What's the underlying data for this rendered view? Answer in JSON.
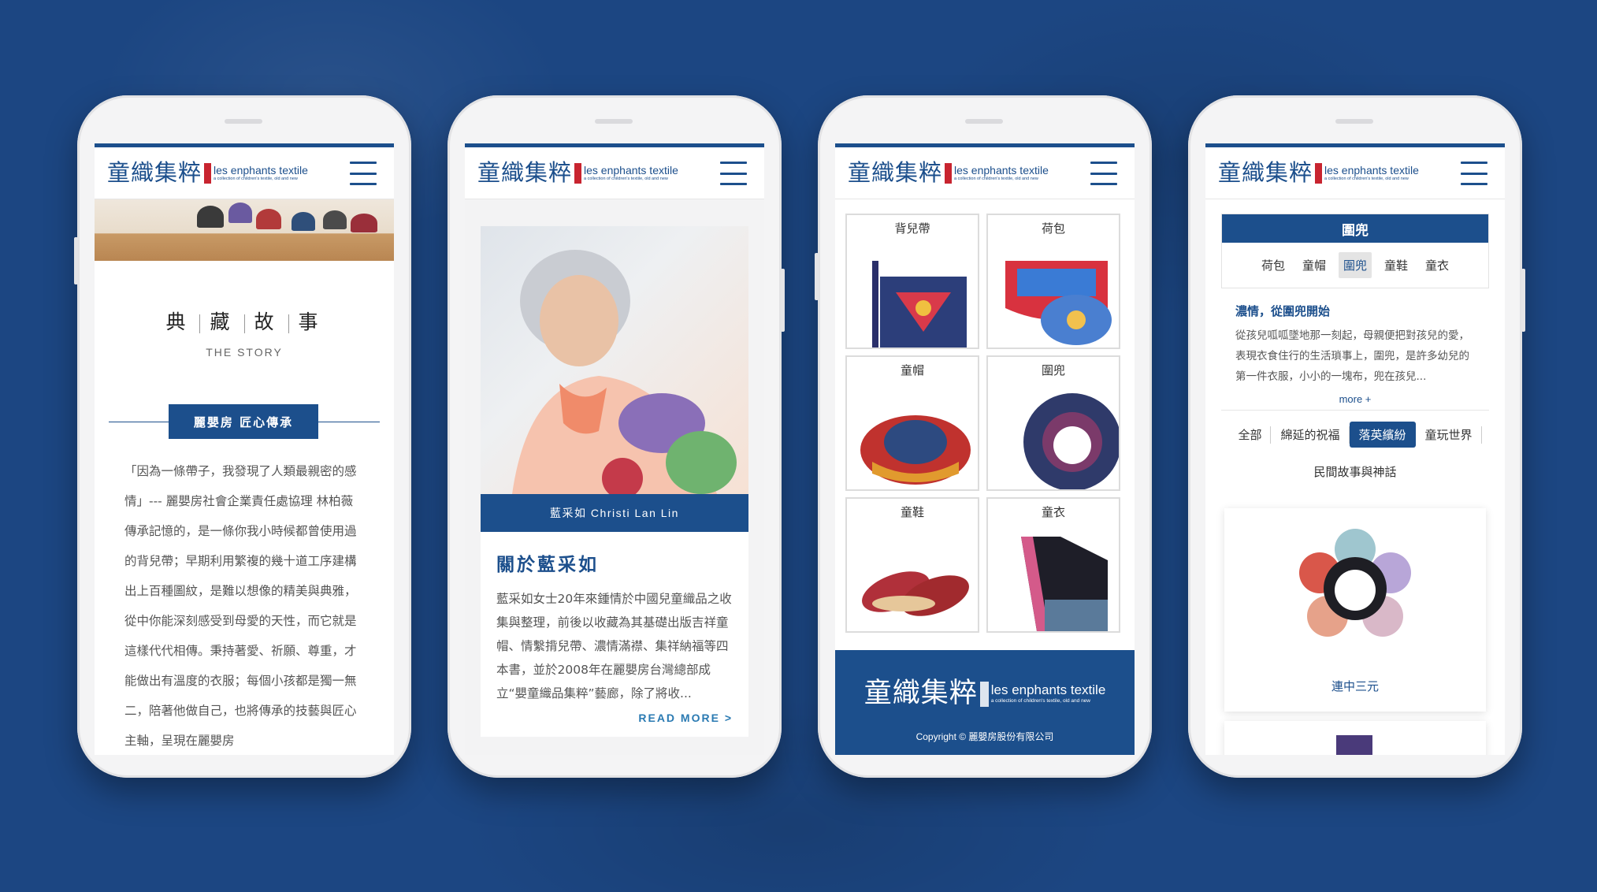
{
  "brand": {
    "logo_cn": "童織集粹",
    "logo_en": "les enphants textile",
    "logo_tagline": "a collection of children's textile, old and new"
  },
  "phone1": {
    "title_chars": [
      "典",
      "藏",
      "故",
      "事"
    ],
    "subtitle": "THE STORY",
    "badge": "麗嬰房 匠心傳承",
    "body": "「因為一條帶子，我發現了人類最親密的感情」--- 麗嬰房社會企業責任處協理 林柏薇傳承記憶的，是一條你我小時候都曾使用過的背兒帶；早期利用繁複的幾十道工序建構出上百種圖紋，是難以想像的精美與典雅，從中你能深刻感受到母愛的天性，而它就是這樣代代相傳。秉持著愛、祈願、尊重，才能做出有溫度的衣服；每個小孩都是獨一無二，陪著他做自己，也將傳承的技藝與匠心主軸，呈現在麗嬰房"
  },
  "phone2": {
    "caption": "藍采如 Christi Lan Lin",
    "heading": "關於藍采如",
    "body": "藍采如女士20年來鍾情於中國兒童織品之收集與整理，前後以收藏為其基礎出版吉祥童帽、情繫揹兒帶、濃情滿襟、集祥納福等四本書，並於2008年在麗嬰房台灣總部成立“嬰童織品集粹”藝廊，除了將收...",
    "read_more": "READ MORE >"
  },
  "phone3": {
    "categories": [
      "背兒帶",
      "荷包",
      "童帽",
      "圍兜",
      "童鞋",
      "童衣"
    ],
    "copyright": "Copyright © 麗嬰房股份有限公司"
  },
  "phone4": {
    "tab_heading": "圍兜",
    "tabs": [
      "荷包",
      "童帽",
      "圍兜",
      "童鞋",
      "童衣"
    ],
    "active_tab": "圍兜",
    "article_title": "濃情，從圍兜開始",
    "article_body": "從孩兒呱呱墜地那一刻起，母親便把對孩兒的愛，表現衣食住行的生活瑣事上，圍兜，是許多幼兒的第一件衣服，小小的一塊布，兜在孩兒...",
    "more": "more +",
    "filters": [
      "全部",
      "綿延的祝福",
      "落英繽紛",
      "童玩世界",
      "民間故事與神話"
    ],
    "active_filter": "落英繽紛",
    "product_name": "連中三元"
  },
  "colors": {
    "background": "#1c4682",
    "brand_blue": "#1c4f8c",
    "accent_red": "#c8242f",
    "link_blue": "#2a7ab2"
  }
}
